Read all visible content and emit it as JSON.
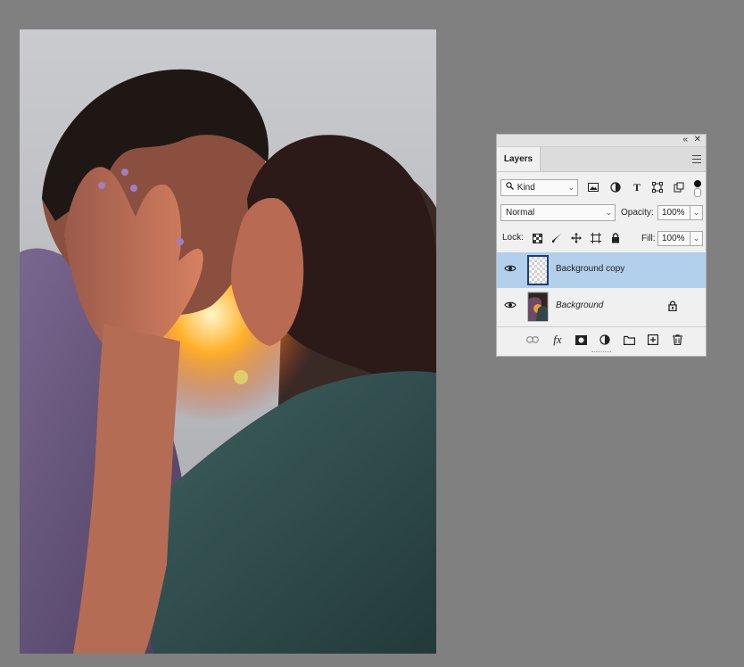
{
  "canvas": {
    "background": "#808080",
    "image_subject": "couple-photo"
  },
  "layers_panel": {
    "collapse_glyph": "«",
    "close_glyph": "✕",
    "tab_label": "Layers",
    "filter": {
      "kind_label": "Kind",
      "icons": [
        "image-filter-icon",
        "adjustment-filter-icon",
        "type-filter-icon",
        "shape-filter-icon",
        "smart-object-filter-icon"
      ]
    },
    "blend_mode": "Normal",
    "opacity_label": "Opacity:",
    "opacity_value": "100%",
    "lock_label": "Lock:",
    "lock_icons": [
      "lock-transparent-icon",
      "lock-image-icon",
      "lock-position-icon",
      "lock-artboard-icon",
      "lock-all-icon"
    ],
    "fill_label": "Fill:",
    "fill_value": "100%",
    "layers": [
      {
        "name": "Background copy",
        "selected": true,
        "visible": true,
        "thumbnail": "transparent-checker",
        "locked": false
      },
      {
        "name": "Background",
        "selected": false,
        "visible": true,
        "thumbnail": "photo",
        "locked": true,
        "italic": true
      }
    ],
    "bottom_icons": [
      "link-layers-icon",
      "fx-icon",
      "layer-mask-icon",
      "adjustment-layer-icon",
      "group-folder-icon",
      "new-layer-icon",
      "trash-icon"
    ],
    "fx_text": "fx",
    "colors": {
      "selected_row": "#b2d0ec",
      "panel_bg": "#f0f0f0"
    }
  }
}
